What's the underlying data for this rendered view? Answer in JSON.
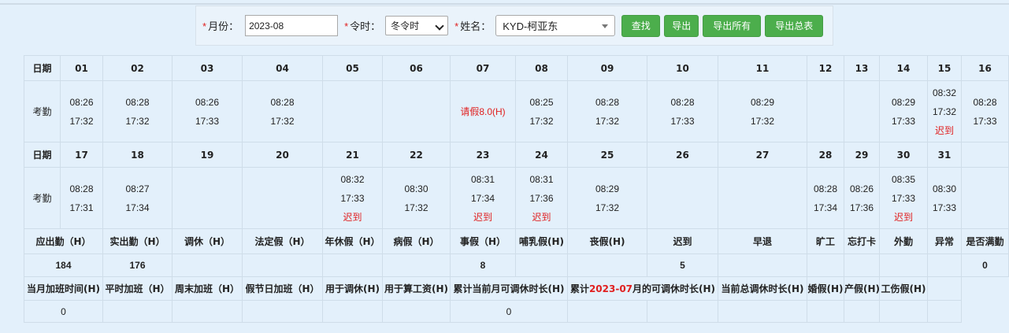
{
  "filters": {
    "month_label": "月份：",
    "month_value": "2023-08",
    "season_label": "令时：",
    "season_value": "冬令时",
    "name_label": "姓名：",
    "name_value": "KYD-柯亚东",
    "required_mark": "*"
  },
  "buttons": {
    "search": "查找",
    "export": "导出",
    "export_all": "导出所有",
    "export_summary": "导出总表"
  },
  "labels": {
    "date": "日期",
    "attendance": "考勤",
    "late": "迟到"
  },
  "week1": {
    "days": [
      "01",
      "02",
      "03",
      "04",
      "05",
      "06",
      "07",
      "08",
      "09",
      "10",
      "11",
      "12",
      "13",
      "14",
      "15",
      "16"
    ],
    "cells": [
      {
        "in": "08:26",
        "out": "17:32",
        "note": ""
      },
      {
        "in": "08:28",
        "out": "17:32",
        "note": ""
      },
      {
        "in": "08:26",
        "out": "17:33",
        "note": ""
      },
      {
        "in": "08:28",
        "out": "17:32",
        "note": ""
      },
      {
        "in": "",
        "out": "",
        "note": ""
      },
      {
        "in": "",
        "out": "",
        "note": ""
      },
      {
        "in": "",
        "out": "",
        "note": "请假8.0(H)"
      },
      {
        "in": "08:25",
        "out": "17:32",
        "note": ""
      },
      {
        "in": "08:28",
        "out": "17:32",
        "note": ""
      },
      {
        "in": "08:28",
        "out": "17:33",
        "note": ""
      },
      {
        "in": "08:29",
        "out": "17:32",
        "note": ""
      },
      {
        "in": "",
        "out": "",
        "note": ""
      },
      {
        "in": "",
        "out": "",
        "note": ""
      },
      {
        "in": "08:29",
        "out": "17:33",
        "note": ""
      },
      {
        "in": "08:32",
        "out": "17:32",
        "note": "迟到"
      },
      {
        "in": "08:28",
        "out": "17:33",
        "note": ""
      }
    ]
  },
  "week2": {
    "days": [
      "17",
      "18",
      "19",
      "20",
      "21",
      "22",
      "23",
      "24",
      "25",
      "26",
      "27",
      "28",
      "29",
      "30",
      "31",
      ""
    ],
    "cells": [
      {
        "in": "08:28",
        "out": "17:31",
        "note": ""
      },
      {
        "in": "08:27",
        "out": "17:34",
        "note": ""
      },
      {
        "in": "",
        "out": "",
        "note": ""
      },
      {
        "in": "",
        "out": "",
        "note": ""
      },
      {
        "in": "08:32",
        "out": "17:33",
        "note": "迟到"
      },
      {
        "in": "08:30",
        "out": "17:32",
        "note": ""
      },
      {
        "in": "08:31",
        "out": "17:34",
        "note": "迟到"
      },
      {
        "in": "08:31",
        "out": "17:36",
        "note": "迟到"
      },
      {
        "in": "08:29",
        "out": "17:32",
        "note": ""
      },
      {
        "in": "",
        "out": "",
        "note": ""
      },
      {
        "in": "",
        "out": "",
        "note": ""
      },
      {
        "in": "08:28",
        "out": "17:34",
        "note": ""
      },
      {
        "in": "08:26",
        "out": "17:36",
        "note": ""
      },
      {
        "in": "08:35",
        "out": "17:33",
        "note": "迟到"
      },
      {
        "in": "08:30",
        "out": "17:33",
        "note": ""
      },
      {
        "in": "",
        "out": "",
        "note": ""
      }
    ]
  },
  "summary": {
    "headers": [
      "应出勤（H）",
      "实出勤（H）",
      "调休（H）",
      "法定假（H）",
      "年休假（H）",
      "病假（H）",
      "事假（H）",
      "哺乳假(H)",
      "丧假(H)",
      "迟到",
      "早退",
      "旷工",
      "忘打卡",
      "外勤",
      "异常",
      "是否满勤"
    ],
    "values": [
      "184",
      "176",
      "",
      "",
      "",
      "",
      "8",
      "",
      "",
      "5",
      "",
      "",
      "",
      "",
      "",
      "0"
    ]
  },
  "overtime": {
    "headers": [
      "当月加班时间(H)",
      "平时加班（H）",
      "周末加班（H）",
      "假节日加班（H）",
      "用于调休(H)",
      "用于算工资(H)",
      "累计当前月可调休时长(H)",
      "累计",
      "2023-07",
      "月的可调休时长(H)",
      "当前总调休时长(H)",
      "婚假(H)",
      "产假(H)",
      "工伤假(H)"
    ],
    "values": [
      "0",
      "0"
    ]
  },
  "colors": {
    "accent_red": "#e02020",
    "button_green": "#4cae4c",
    "value_blue": "#2222cc",
    "background": "#e3f0fb"
  }
}
